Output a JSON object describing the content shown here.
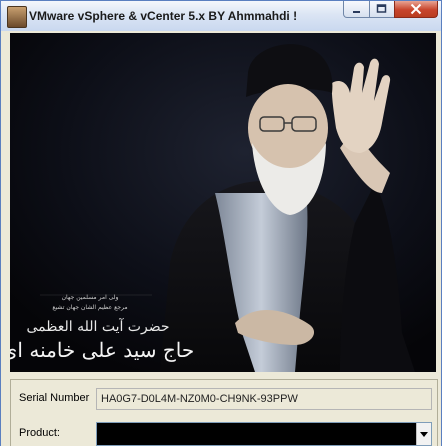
{
  "window": {
    "title": "VMware vSphere & vCenter 5.x BY Ahmmahdi !"
  },
  "image": {
    "caption_small_1": "ولی امر مسلمین جهان",
    "caption_small_2": "مرجع عظیم الشان جهان تشیع",
    "caption_large_1": "حضرت آیت الله العظمی",
    "caption_large_2": "حاج سید علی خامنه ای"
  },
  "form": {
    "serial_label": "Serial Number",
    "serial_value": "HA0G7-D0L4M-NZ0M0-CH9NK-93PPW",
    "product_label": "Product:",
    "product_value": ""
  }
}
